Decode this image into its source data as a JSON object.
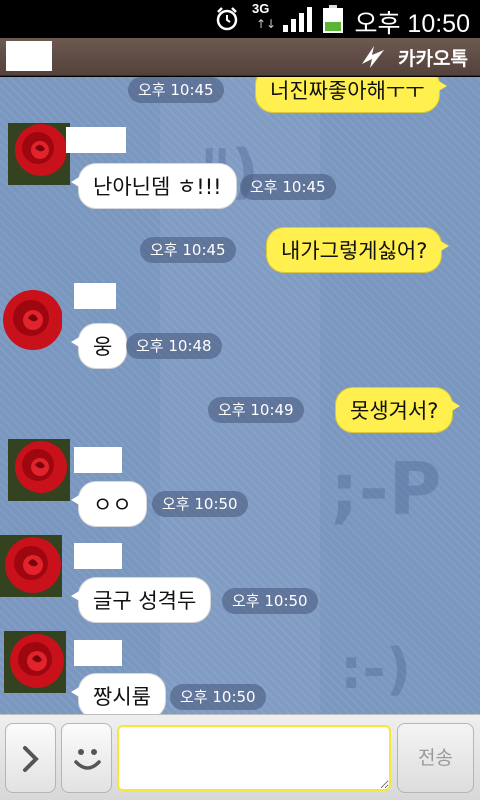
{
  "status_bar": {
    "time": "오후 10:50",
    "network": "3G",
    "network_arrows": "↑↓",
    "icons": [
      "alarm-icon",
      "signal-icon",
      "battery-icon"
    ]
  },
  "title_bar": {
    "app_name": "카카오톡",
    "logo_icon": "kakao-logo-icon"
  },
  "watermarks": {
    "top": "\")",
    "bottom_face": ";-P",
    "tongue": ":-)"
  },
  "messages": [
    {
      "side": "me",
      "text": "너진짜좋아해ㅜㅜ",
      "time": "오후 10:45"
    },
    {
      "side": "them",
      "text": "난아닌뎀 ㅎ!!!",
      "time": "오후 10:45"
    },
    {
      "side": "me",
      "text": "내가그렇게싫어?",
      "time": "오후 10:45"
    },
    {
      "side": "them",
      "text": "웅",
      "time": "오후 10:48"
    },
    {
      "side": "me",
      "text": "못생겨서?",
      "time": "오후 10:49"
    },
    {
      "side": "them",
      "text": "ㅇㅇ",
      "time": "오후 10:50"
    },
    {
      "side": "them",
      "text": "글구 성격두",
      "time": "오후 10:50"
    },
    {
      "side": "them",
      "text": "짱시룸",
      "time": "오후 10:50"
    }
  ],
  "avatar_icon": "red-rose-icon",
  "input_bar": {
    "placeholder": "",
    "send_label": "전송",
    "expand_icon": "chevron-right-icon",
    "emoji_icon": "smiley-icon"
  },
  "colors": {
    "my_bubble": "#fff04f",
    "their_bubble": "#ffffff",
    "chat_bg": "#7a97c0",
    "title_bar": "#5f4c44"
  }
}
